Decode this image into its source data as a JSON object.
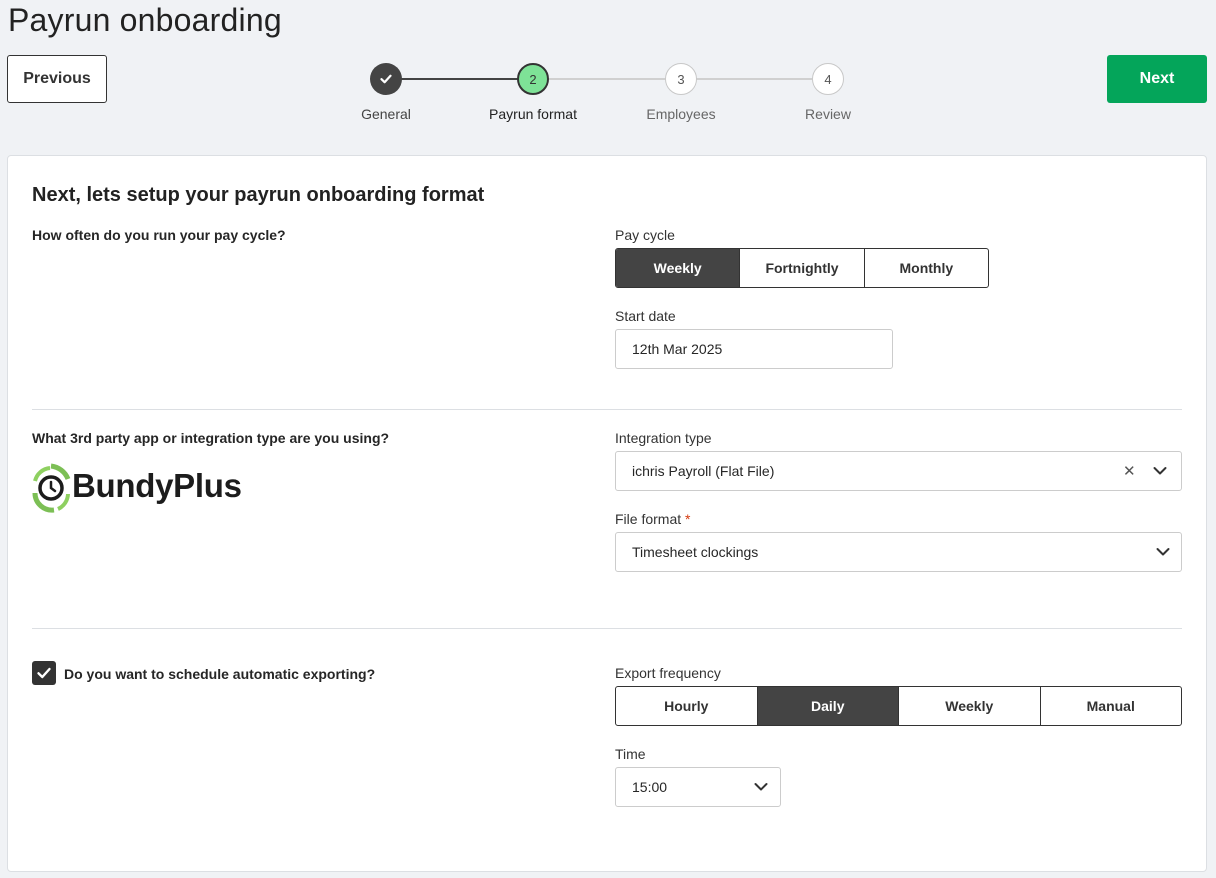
{
  "page": {
    "title": "Payrun onboarding"
  },
  "nav": {
    "previous_label": "Previous",
    "next_label": "Next"
  },
  "stepper": {
    "steps": [
      {
        "number": "1",
        "label": "General",
        "state": "completed"
      },
      {
        "number": "2",
        "label": "Payrun format",
        "state": "current"
      },
      {
        "number": "3",
        "label": "Employees",
        "state": "upcoming"
      },
      {
        "number": "4",
        "label": "Review",
        "state": "upcoming"
      }
    ]
  },
  "form": {
    "title": "Next, lets setup your payrun onboarding format",
    "pay_cycle": {
      "question": "How often do you run your pay cycle?",
      "label": "Pay cycle",
      "options": [
        "Weekly",
        "Fortnightly",
        "Monthly"
      ],
      "selected": "Weekly"
    },
    "start_date": {
      "label": "Start date",
      "value": "12th Mar 2025"
    },
    "integration": {
      "question": "What 3rd party app or integration type are you using?",
      "logo_text": "BundyPlus",
      "type_label": "Integration type",
      "type_value": "ichris Payroll (Flat File)",
      "file_format_label": "File format",
      "required_mark": "*",
      "file_format_value": "Timesheet clockings"
    },
    "export": {
      "question": "Do you want to schedule automatic exporting?",
      "checked": true,
      "frequency_label": "Export frequency",
      "options": [
        "Hourly",
        "Daily",
        "Weekly",
        "Manual"
      ],
      "selected": "Daily",
      "time_label": "Time",
      "time_value": "15:00"
    }
  },
  "colors": {
    "primary": "#04a55a",
    "current_step": "#7ee297",
    "dark": "#444444",
    "background": "#f0f2f5"
  }
}
